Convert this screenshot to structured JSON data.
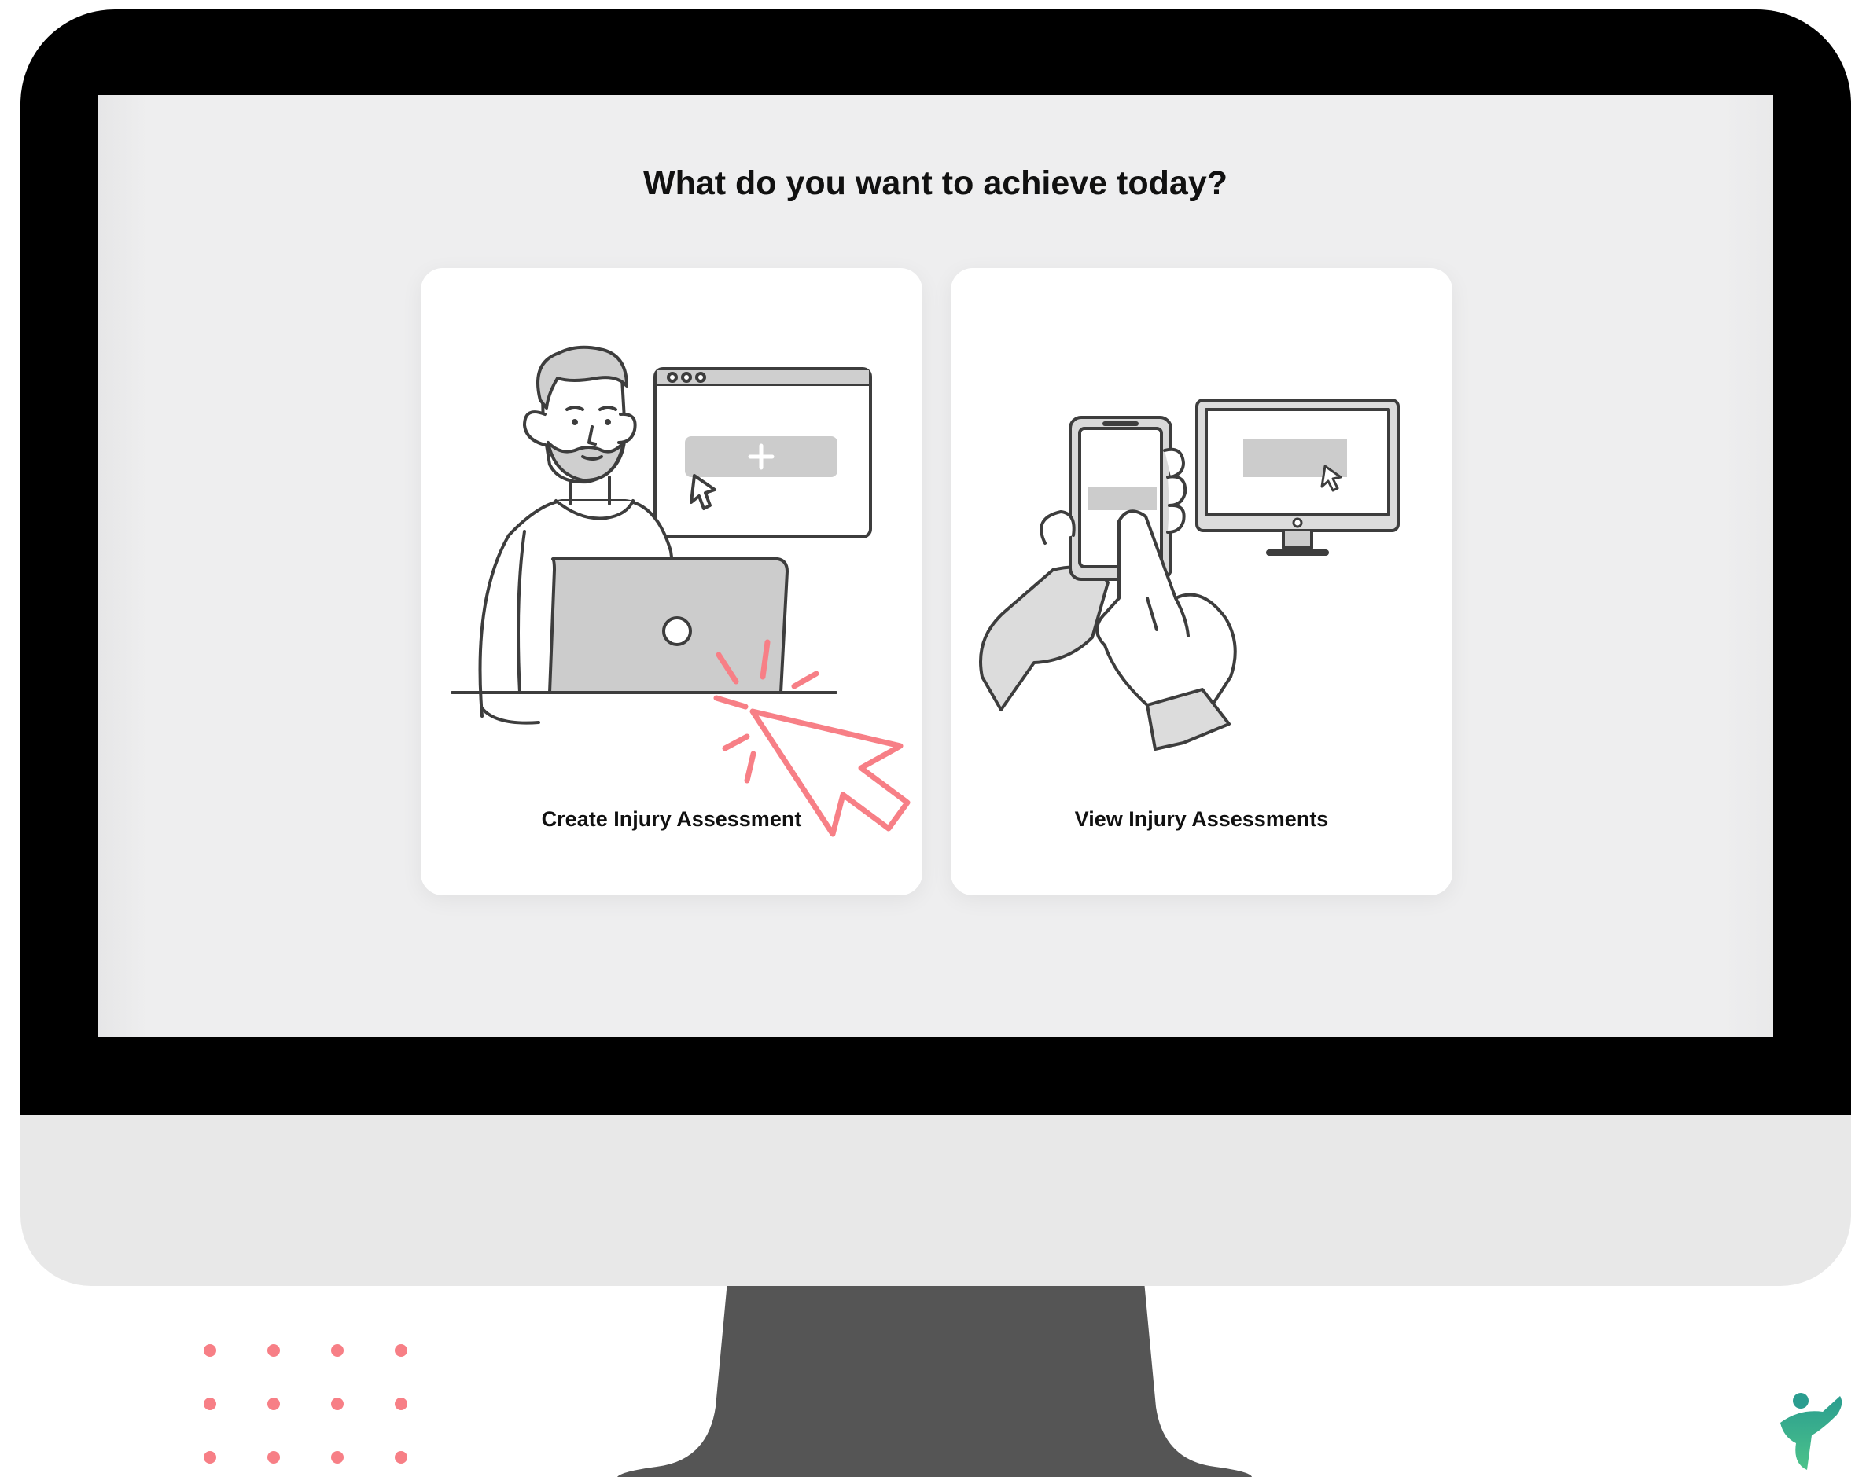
{
  "screen": {
    "title": "What do you want to achieve today?"
  },
  "options": [
    {
      "label": "Create Injury Assessment",
      "icon": "person-laptop-illustration"
    },
    {
      "label": "View Injury Assessments",
      "icon": "phone-monitor-illustration"
    }
  ],
  "colors": {
    "bezel": "#000000",
    "chin": "#e8e8e8",
    "stand": "#555555",
    "screen_bg": "#eeeeef",
    "card_bg": "#ffffff",
    "accent_pink": "#f77f86",
    "illustration_gray": "#c9c9c9",
    "logo_teal": "#2a9d8f",
    "logo_green": "#4cc38a"
  }
}
